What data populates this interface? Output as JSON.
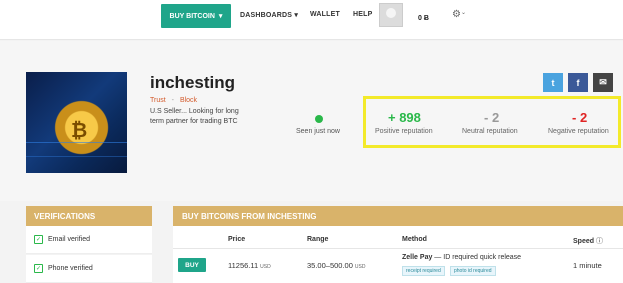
{
  "nav": {
    "buy_bitcoin": "BUY BITCOIN",
    "dashboards": "DASHBOARDS",
    "wallet": "WALLET",
    "help": "HELP",
    "balance": "0 Ƀ",
    "gear_icon": "gear-icon"
  },
  "profile": {
    "username": "inchesting",
    "trust": "Trust",
    "block": "Block",
    "bio": "U.S Seller... Looking for long term partner for trading BTC",
    "seen": "Seen just now",
    "online_color": "#2ab84a"
  },
  "reputation": {
    "positive_value": "+ 898",
    "positive_label": "Positive reputation",
    "neutral_value": "- 2",
    "neutral_label": "Neutral reputation",
    "negative_value": "- 2",
    "negative_label": "Negative reputation",
    "highlight_color": "#f3ea2a"
  },
  "social": {
    "twitter": "t",
    "facebook": "f",
    "email": "✉"
  },
  "verifications": {
    "title": "VERIFICATIONS",
    "items": [
      {
        "label": "Email verified"
      },
      {
        "label": "Phone verified"
      }
    ]
  },
  "buy_table": {
    "title": "BUY BITCOINS FROM INCHESTING",
    "headers": {
      "price": "Price",
      "range": "Range",
      "method": "Method",
      "speed": "Speed"
    },
    "rows": [
      {
        "button": "BUY",
        "price": "11256.11",
        "price_unit": "USD",
        "range": "35.00–500.00",
        "range_unit": "USD",
        "method_name": "Zelle Pay",
        "method_detail": " — ID required quick release",
        "tags": [
          "receipt required",
          "photo id required"
        ],
        "speed": "1 minute"
      }
    ]
  }
}
